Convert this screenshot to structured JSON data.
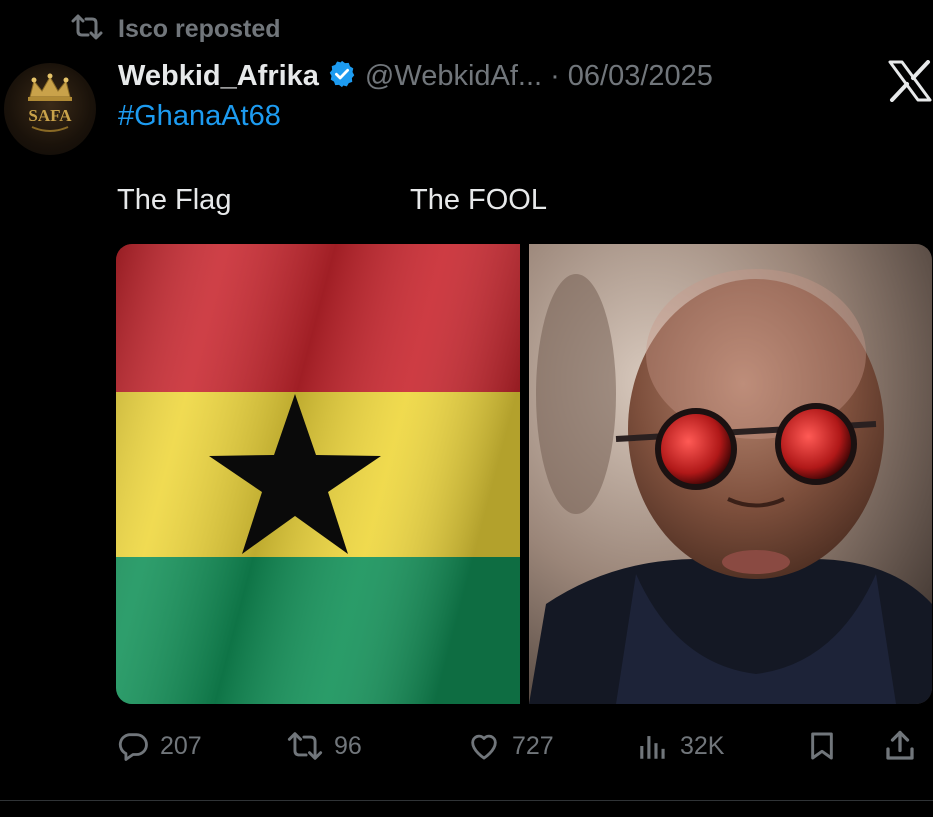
{
  "repost": {
    "text": "Isco reposted",
    "icon": "repost-icon"
  },
  "avatar": {
    "logo_text": "SAFA"
  },
  "author": {
    "name": "Webkid_Afrika",
    "verified_icon": "verified-badge-icon",
    "handle": "@WebkidAf...",
    "separator": "·",
    "date": "06/03/2025"
  },
  "post": {
    "hashtag": "#GhanaAt68",
    "captions": [
      "The Flag",
      "The FOOL"
    ]
  },
  "brand": {
    "icon": "x-logo-icon"
  },
  "actions": {
    "replies": "207",
    "reposts": "96",
    "likes": "727",
    "views": "32K",
    "bookmark_icon": "bookmark-icon",
    "share_icon": "share-icon"
  },
  "colors": {
    "background": "#000000",
    "text": "#e7e9ea",
    "muted": "#71767b",
    "link": "#1d9bf0",
    "verified": "#1d9bf0"
  }
}
